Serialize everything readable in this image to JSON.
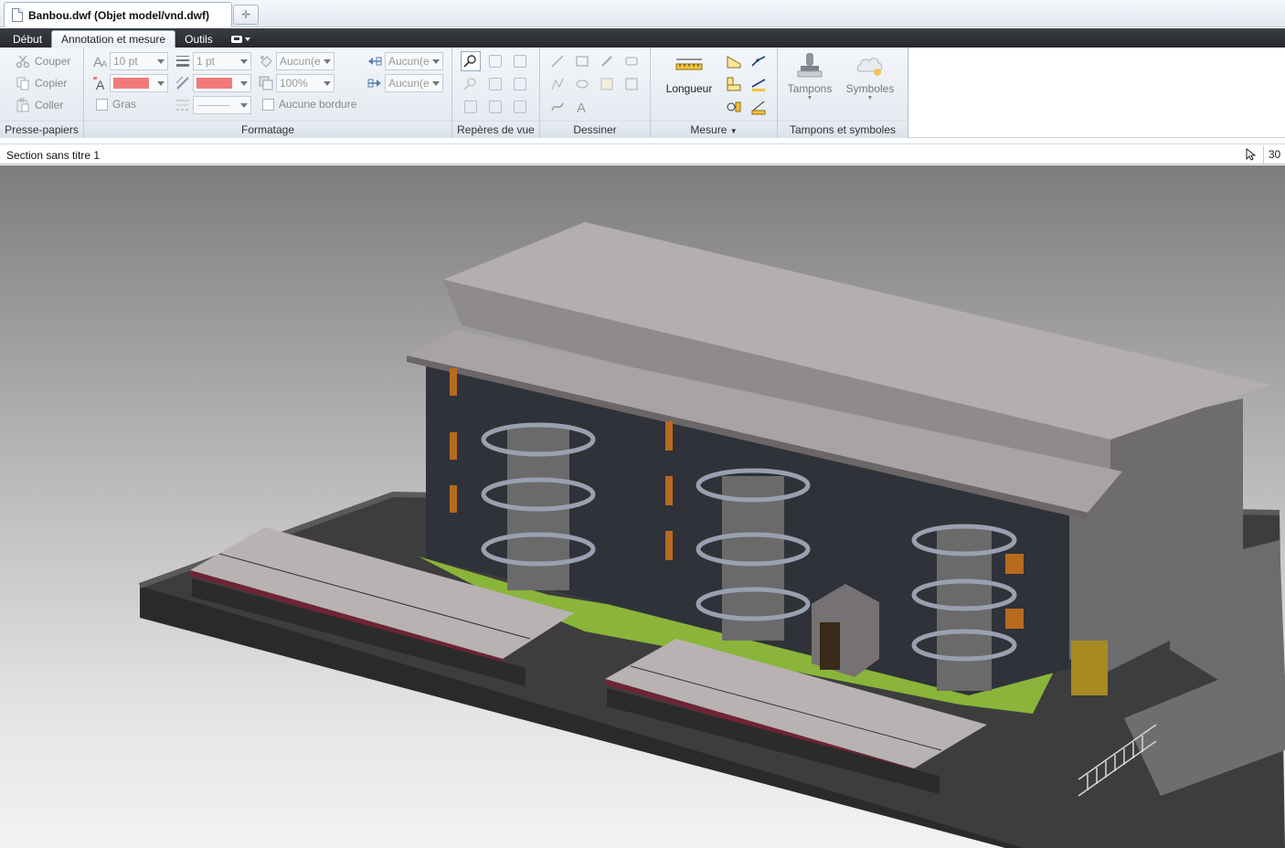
{
  "document_tab": {
    "title": "Banbou.dwf (Objet model/vnd.dwf)",
    "file_icon": "document-icon",
    "new_tab_icon": "add-tab-icon"
  },
  "ribbon_tabs": [
    {
      "label": "Début",
      "active": false
    },
    {
      "label": "Annotation et mesure",
      "active": true
    },
    {
      "label": "Outils",
      "active": false
    }
  ],
  "clipboard": {
    "label": "Presse-papiers",
    "cut": "Couper",
    "copy": "Copier",
    "paste": "Coller"
  },
  "formatting": {
    "label": "Formatage",
    "font_size": "10 pt",
    "line_weight": "1 pt",
    "fill": "Aucun(e",
    "opacity": "100%",
    "start_arrow": "Aucun(e",
    "end_arrow": "Aucun(e",
    "bold": "Gras",
    "no_border": "Aucune bordure",
    "text_color": "#f37a7a",
    "line_color": "#f37a7a"
  },
  "view_markers": {
    "label": "Repères de vue"
  },
  "draw": {
    "label": "Dessiner"
  },
  "measure": {
    "label": "Mesure",
    "length": "Longueur"
  },
  "stamps": {
    "label": "Tampons et symboles",
    "stamps_btn": "Tampons",
    "symbols_btn": "Symboles"
  },
  "section": {
    "title": "Section sans titre 1",
    "page": "30"
  }
}
